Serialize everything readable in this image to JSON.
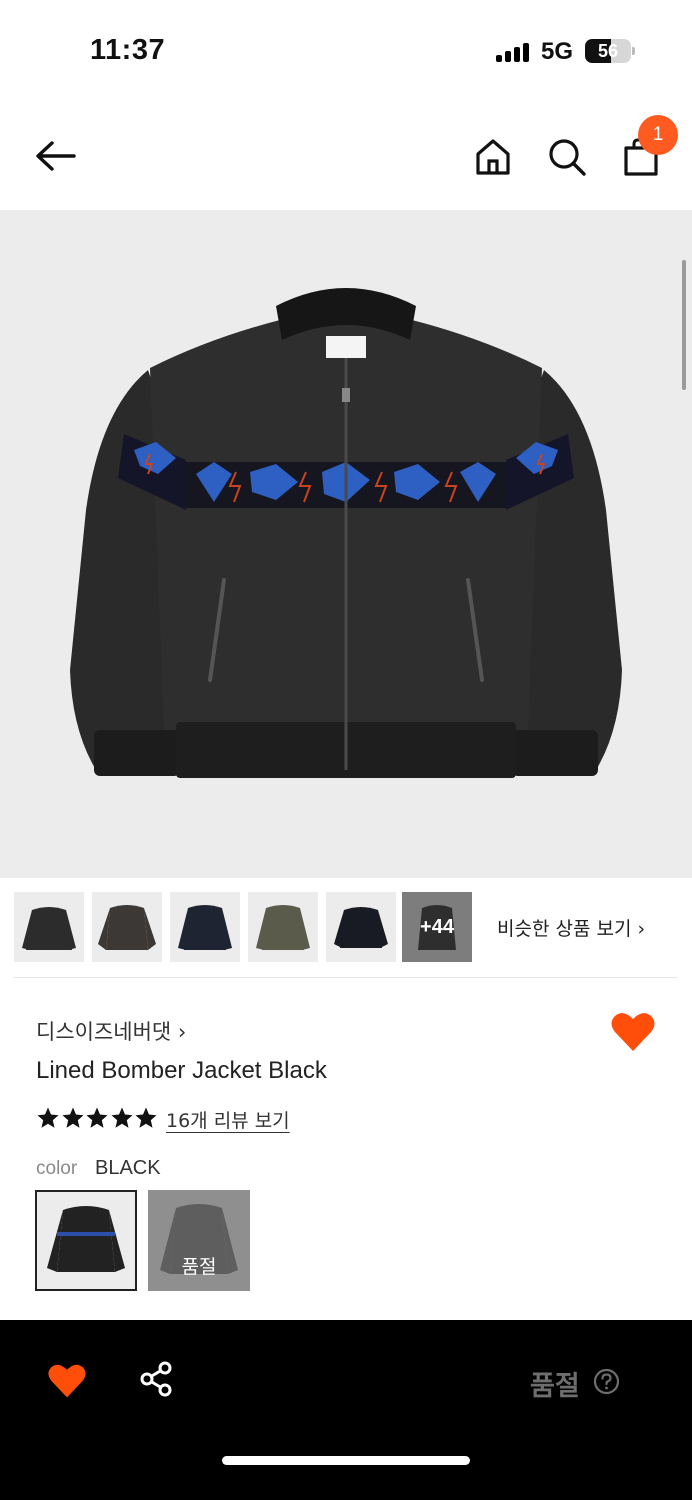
{
  "status_bar": {
    "time": "11:37",
    "network": "5G",
    "battery": "56",
    "battery_level_percent": 56
  },
  "nav": {
    "icons": [
      "back-arrow-icon",
      "home-icon",
      "search-icon",
      "cart-icon"
    ],
    "cart_count": "1",
    "badge_color": "#ff5a1f"
  },
  "thumbnails": {
    "items": [
      "thumb-1",
      "thumb-2",
      "thumb-3",
      "thumb-4",
      "thumb-5"
    ],
    "more_label": "+44",
    "similar_label": "비슷한 상품 보기 ›"
  },
  "product": {
    "brand": "디스이즈네버댓 ›",
    "name": "Lined Bomber Jacket Black",
    "rating_stars": 5,
    "review_link": "16개 리뷰 보기",
    "color_label": "color",
    "color_value": "BLACK",
    "soldout_swatch_label": "품절",
    "accent_color": "#ff4d0a"
  },
  "bottom_bar": {
    "soldout_label": "품절",
    "icons": [
      "heart-icon",
      "share-icon",
      "help-icon"
    ]
  }
}
